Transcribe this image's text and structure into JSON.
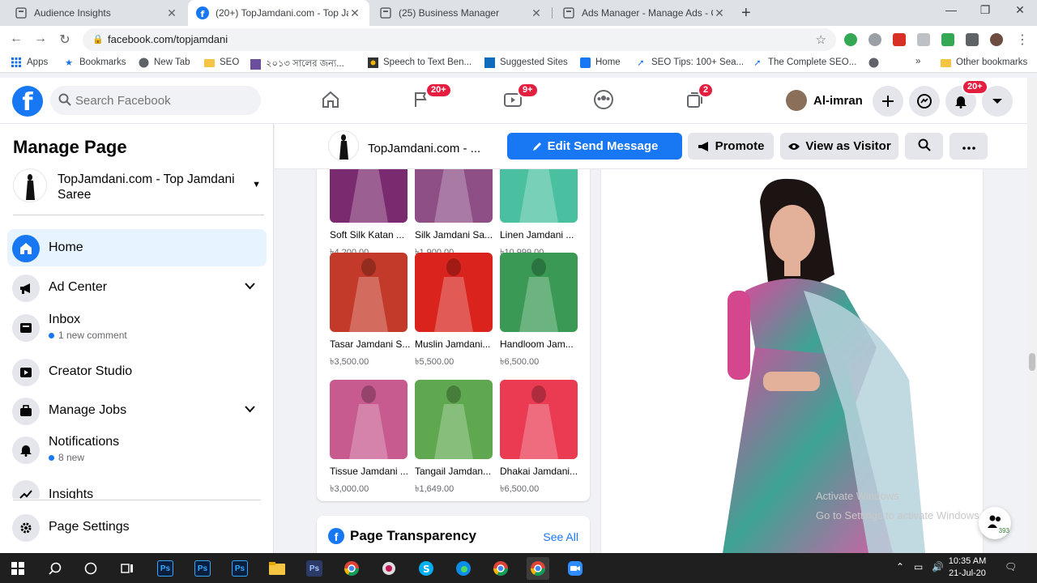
{
  "browser": {
    "tabs": [
      {
        "title": "Audience Insights",
        "active": false
      },
      {
        "title": "(20+) TopJamdani.com - Top Jam",
        "active": true
      },
      {
        "title": "(25) Business Manager",
        "active": false
      },
      {
        "title": "Ads Manager - Manage Ads - Ca",
        "active": false
      }
    ],
    "url": "facebook.com/topjamdani",
    "bookmarks": [
      "Apps",
      "Bookmarks",
      "New Tab",
      "SEO",
      "২০১৩ সালের জন্য...",
      "Speech to Text Ben...",
      "Suggested Sites",
      "Home",
      "SEO Tips: 100+ Sea...",
      "The Complete SEO...",
      "»",
      "Other bookmarks"
    ]
  },
  "fb": {
    "search_placeholder": "Search Facebook",
    "badges": {
      "pages": "20+",
      "watch": "9+",
      "marketplace": "2",
      "notifications": "20+"
    },
    "profile_name": "Al-imran"
  },
  "sidebar": {
    "title": "Manage Page",
    "page_name": "TopJamdani.com - Top Jamdani Saree",
    "items": [
      {
        "label": "Home",
        "sub": ""
      },
      {
        "label": "Ad Center",
        "sub": ""
      },
      {
        "label": "Inbox",
        "sub": "1 new comment"
      },
      {
        "label": "Creator Studio",
        "sub": ""
      },
      {
        "label": "Manage Jobs",
        "sub": ""
      },
      {
        "label": "Notifications",
        "sub": "8 new"
      },
      {
        "label": "Insights",
        "sub": ""
      },
      {
        "label": "Page Settings",
        "sub": ""
      }
    ]
  },
  "header": {
    "page_title": "TopJamdani.com - ...",
    "edit_button": "Edit Send Message",
    "promote_button": "Promote",
    "visitor_button": "View as Visitor"
  },
  "shop": {
    "products": [
      {
        "name": "Soft Silk Katan ...",
        "price": "৳4,200.00",
        "color": "#7a2a6e"
      },
      {
        "name": "Silk Jamdani Sa...",
        "price": "৳1,900.00",
        "color": "#8d4f86"
      },
      {
        "name": "Linen Jamdani ...",
        "price": "৳10,999.00",
        "color": "#4bc0a0"
      },
      {
        "name": "Tasar Jamdani S...",
        "price": "৳3,500.00",
        "color": "#c43a2a"
      },
      {
        "name": "Muslin Jamdani...",
        "price": "৳5,500.00",
        "color": "#d9231c"
      },
      {
        "name": "Handloom Jam...",
        "price": "৳6,500.00",
        "color": "#3a9a55"
      },
      {
        "name": "Tissue Jamdani ...",
        "price": "৳3,000.00",
        "color": "#c75a8e"
      },
      {
        "name": "Tangail Jamdan...",
        "price": "৳1,649.00",
        "color": "#5fa850"
      },
      {
        "name": "Dhakai Jamdani...",
        "price": "৳6,500.00",
        "color": "#ea3b53"
      }
    ]
  },
  "transparency": {
    "title": "Page Transparency",
    "see_all": "See All"
  },
  "watermark": {
    "line1": "Activate Windows",
    "line2": "Go to Settings to activate Windows."
  },
  "float_count": "393",
  "taskbar": {
    "time": "10:35 AM",
    "date": "21-Jul-20"
  }
}
